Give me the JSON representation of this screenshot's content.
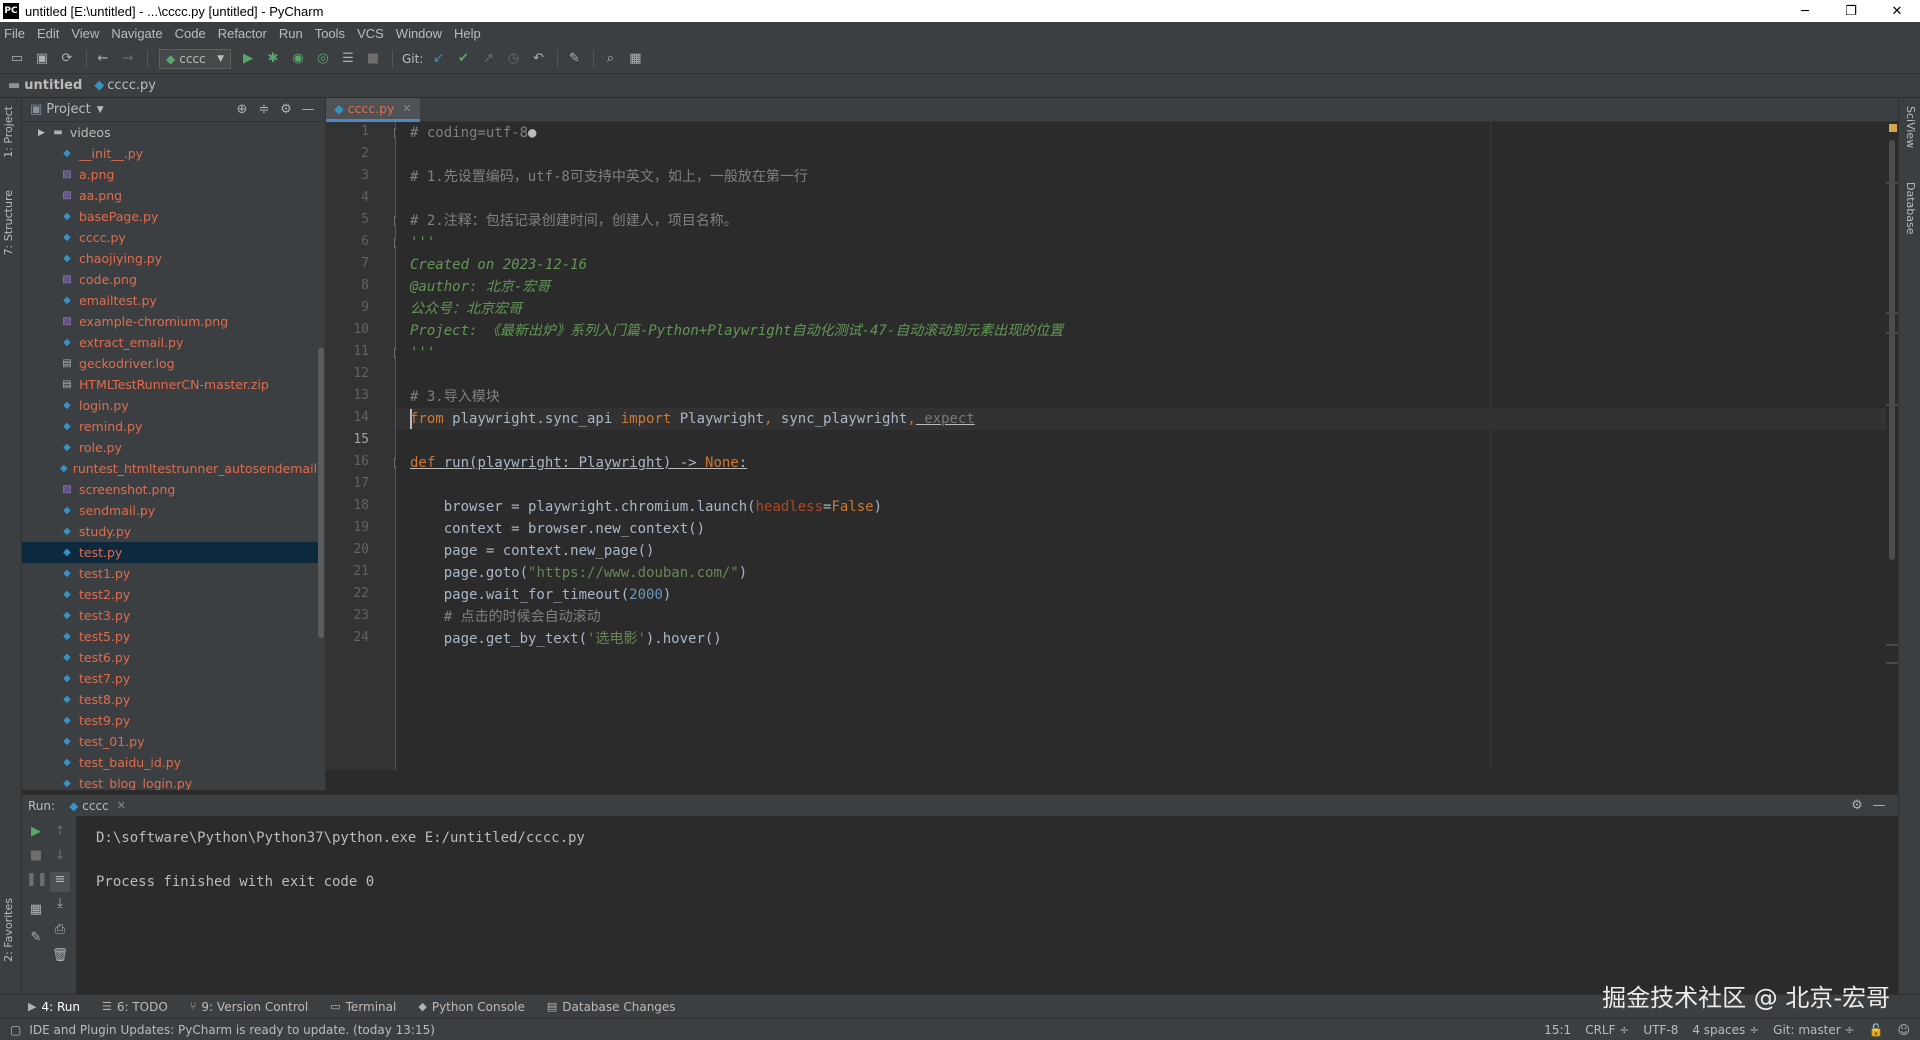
{
  "window": {
    "title": "untitled [E:\\untitled] - ...\\cccc.py [untitled] - PyCharm",
    "app_icon": "PC",
    "controls": [
      "─",
      "❐",
      "✕"
    ]
  },
  "menu": [
    "File",
    "Edit",
    "View",
    "Navigate",
    "Code",
    "Refactor",
    "Run",
    "Tools",
    "VCS",
    "Window",
    "Help"
  ],
  "toolbar": {
    "run_config": "cccc",
    "git_label": "Git:"
  },
  "navbar": {
    "project": "untitled",
    "file": "cccc.py"
  },
  "left_stripe": {
    "project_tab": "1: Project",
    "structure_tab": "7: Structure",
    "favorites_tab": "2: Favorites"
  },
  "right_stripe": {
    "sciview_tab": "SciView",
    "database_tab": "Database"
  },
  "project_panel": {
    "title": "Project",
    "folder": "videos",
    "files": [
      {
        "name": "__init__.py",
        "type": "py"
      },
      {
        "name": "a.png",
        "type": "img"
      },
      {
        "name": "aa.png",
        "type": "img"
      },
      {
        "name": "basePage.py",
        "type": "py"
      },
      {
        "name": "cccc.py",
        "type": "py"
      },
      {
        "name": "chaojiying.py",
        "type": "py"
      },
      {
        "name": "code.png",
        "type": "img"
      },
      {
        "name": "emailtest.py",
        "type": "py"
      },
      {
        "name": "example-chromium.png",
        "type": "img"
      },
      {
        "name": "extract_email.py",
        "type": "py"
      },
      {
        "name": "geckodriver.log",
        "type": "file"
      },
      {
        "name": "HTMLTestRunnerCN-master.zip",
        "type": "file"
      },
      {
        "name": "login.py",
        "type": "py"
      },
      {
        "name": "remind.py",
        "type": "py"
      },
      {
        "name": "role.py",
        "type": "py"
      },
      {
        "name": "runtest_htmltestrunner_autosendemail.py",
        "type": "py"
      },
      {
        "name": "screenshot.png",
        "type": "img"
      },
      {
        "name": "sendmail.py",
        "type": "py"
      },
      {
        "name": "study.py",
        "type": "py"
      },
      {
        "name": "test.py",
        "type": "py",
        "selected": true
      },
      {
        "name": "test1.py",
        "type": "py"
      },
      {
        "name": "test2.py",
        "type": "py"
      },
      {
        "name": "test3.py",
        "type": "py"
      },
      {
        "name": "test5.py",
        "type": "py"
      },
      {
        "name": "test6.py",
        "type": "py"
      },
      {
        "name": "test7.py",
        "type": "py"
      },
      {
        "name": "test8.py",
        "type": "py"
      },
      {
        "name": "test9.py",
        "type": "py"
      },
      {
        "name": "test_01.py",
        "type": "py"
      },
      {
        "name": "test_baidu_id.py",
        "type": "py"
      },
      {
        "name": "test_blog_login.py",
        "type": "py"
      }
    ]
  },
  "editor": {
    "tab": "cccc.py",
    "current_line": 15,
    "lines": [
      {
        "n": 1,
        "t": "# coding=utf-8🔥"
      },
      {
        "n": 2,
        "t": ""
      },
      {
        "n": 3,
        "t": "# 1.先设置编码，utf-8可支持中英文，如上，一般放在第一行"
      },
      {
        "n": 4,
        "t": ""
      },
      {
        "n": 5,
        "t": "# 2.注释：包括记录创建时间，创建人，项目名称。"
      },
      {
        "n": 6,
        "t": "'''"
      },
      {
        "n": 7,
        "t": "Created on 2023-12-16"
      },
      {
        "n": 8,
        "t": "@author: 北京-宏哥"
      },
      {
        "n": 9,
        "t": "公众号：北京宏哥"
      },
      {
        "n": 10,
        "t": "Project: 《最新出炉》系列入门篇-Python+Playwright自动化测试-47-自动滚动到元素出现的位置"
      },
      {
        "n": 11,
        "t": "'''"
      },
      {
        "n": 12,
        "t": ""
      },
      {
        "n": 13,
        "t": "# 3.导入模块"
      },
      {
        "n": 14,
        "t": "from playwright.sync_api import Playwright, sync_playwright, expect"
      },
      {
        "n": 15,
        "t": ""
      },
      {
        "n": 16,
        "t": "def run(playwright: Playwright) -> None:"
      },
      {
        "n": 17,
        "t": ""
      },
      {
        "n": 18,
        "t": "    browser = playwright.chromium.launch(headless=False)"
      },
      {
        "n": 19,
        "t": "    context = browser.new_context()"
      },
      {
        "n": 20,
        "t": "    page = context.new_page()"
      },
      {
        "n": 21,
        "t": "    page.goto(\"https://www.douban.com/\")"
      },
      {
        "n": 22,
        "t": "    page.wait_for_timeout(2000)"
      },
      {
        "n": 23,
        "t": "    # 点击的时候会自动滚动"
      },
      {
        "n": 24,
        "t": "    page.get_by_text('选电影').hover()"
      }
    ],
    "tokens": {
      "l1": "# coding=utf-8",
      "l3": "# 1.先设置编码，utf-8可支持中英文，如上，一般放在第一行",
      "l5": "# 2.注释：包括记录创建时间，创建人，项目名称。",
      "l6": "'''",
      "l7": "Created on 2023-12-16",
      "l8": "@author: 北京-宏哥",
      "l9": "公众号：北京宏哥",
      "l10": "Project: 《最新出炉》系列入门篇-Python+Playwright自动化测试-47-自动滚动到元素出现的位置",
      "l11": "'''",
      "l13": "# 3.导入模块",
      "l14_from": "from",
      "l14_mod": " playwright.sync_api ",
      "l14_import": "import",
      "l14_a": " Playwright",
      "l14_c1": ",",
      "l14_b": " sync_playwright",
      "l14_c2": ",",
      "l14_c": " expect",
      "l16_def": "def",
      "l16_rest": " run(playwright: Playwright) -> ",
      "l16_none": "None",
      "l16_colon": ":",
      "l18_a": "    browser = playwright.chromium.launch(",
      "l18_param": "headless",
      "l18_eq": "=",
      "l18_false": "False",
      "l18_end": ")",
      "l19": "    context = browser.new_context()",
      "l20": "    page = context.new_page()",
      "l21_a": "    page.goto(",
      "l21_str": "\"https://www.douban.com/\"",
      "l21_end": ")",
      "l22_a": "    page.wait_for_timeout(",
      "l22_num": "2000",
      "l22_end": ")",
      "l23": "    # 点击的时候会自动滚动",
      "l24_a": "    page.get_by_text(",
      "l24_str": "'选电影'",
      "l24_end": ").hover()"
    }
  },
  "run_panel": {
    "label": "Run:",
    "tab": "cccc",
    "output": [
      "D:\\software\\Python\\Python37\\python.exe E:/untitled/cccc.py",
      "",
      "Process finished with exit code 0"
    ]
  },
  "tool_windows": [
    "4: Run",
    "6: TODO",
    "9: Version Control",
    "Terminal",
    "Python Console",
    "Database Changes"
  ],
  "watermark": "掘金技术社区 @ 北京-宏哥",
  "status": {
    "message": "IDE and Plugin Updates: PyCharm is ready to update. (today 13:15)",
    "position": "15:1",
    "line_sep": "CRLF ÷",
    "encoding": "UTF-8",
    "indent": "4 spaces ÷",
    "git": "Git: master ÷"
  },
  "colors": {
    "accent": "#4a88c7",
    "file_modified": "#e06c4d",
    "comment": "#808080",
    "docstring": "#629755",
    "keyword": "#cc7832",
    "string": "#6a8759",
    "number": "#6897bb"
  }
}
